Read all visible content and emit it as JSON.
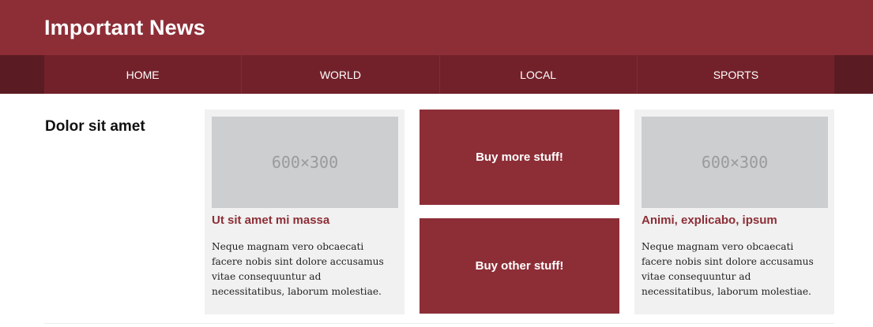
{
  "header": {
    "title": "Important News"
  },
  "nav": {
    "items": [
      "HOME",
      "WORLD",
      "LOCAL",
      "SPORTS"
    ]
  },
  "main": {
    "heading": "Dolor sit amet",
    "cards": [
      {
        "image_label": "600×300",
        "title": "Ut sit amet mi massa",
        "text": "Neque magnam vero obcaecati facere nobis sint dolore accusamus vitae consequuntur ad necessitatibus, laborum molestiae."
      },
      {
        "image_label": "600×300",
        "title": "Animi, explicabo, ipsum",
        "text": "Neque magnam vero obcaecati facere nobis sint dolore accusamus vitae consequuntur ad necessitatibus, laborum molestiae."
      }
    ],
    "ads": [
      "Buy more stuff!",
      "Buy other stuff!"
    ]
  },
  "colors": {
    "brand": "#8d2e37",
    "nav": "#72212a",
    "nav_edge": "#5b1b22",
    "card_bg": "#f0f1f0",
    "placeholder_bg": "#cdcecf"
  }
}
